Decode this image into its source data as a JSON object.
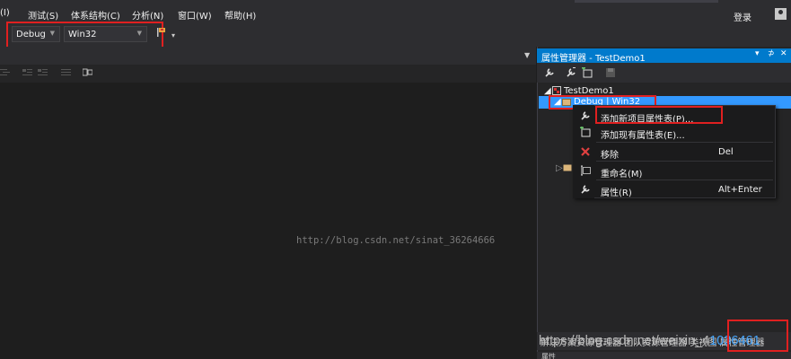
{
  "menubar": {
    "items": [
      "(I)",
      "测试(S)",
      "体系结构(C)",
      "分析(N)",
      "窗口(W)",
      "帮助(H)"
    ],
    "login": "登录"
  },
  "toolbar": {
    "config_combo": "Debug",
    "platform_combo": "Win32",
    "highlight_color": "#e02020"
  },
  "document": {
    "watermark": "http://blog.csdn.net/sinat_36264666"
  },
  "property_manager": {
    "title": "属性管理器 - TestDemo1",
    "title_buttons": [
      "▾",
      "⊅",
      "✕"
    ],
    "tree": {
      "project": "TestDemo1",
      "config": "Debug | Win32"
    },
    "accent_color": "#007acc",
    "selection_color": "#3399ff"
  },
  "context_menu": {
    "items": [
      {
        "label": "添加新项目属性表(P)...",
        "shortcut": "",
        "icon": "wrench-add-icon"
      },
      {
        "label": "添加现有属性表(E)...",
        "shortcut": "",
        "icon": "sheet-add-icon"
      },
      {
        "label": "移除",
        "shortcut": "Del",
        "icon": "red-x-icon"
      },
      {
        "label": "重命名(M)",
        "shortcut": "",
        "icon": "rename-icon"
      },
      {
        "label": "属性(R)",
        "shortcut": "Alt+Enter",
        "icon": "wrench-icon"
      }
    ]
  },
  "bottom": {
    "tabs_text": "解决方案资源管理器  团队资源管理器  类视图  属性管理器",
    "watermark_prefix": "https://blog.csdn.net/weixin_4",
    "watermark_number": "1036461",
    "properties_label": "属性"
  }
}
